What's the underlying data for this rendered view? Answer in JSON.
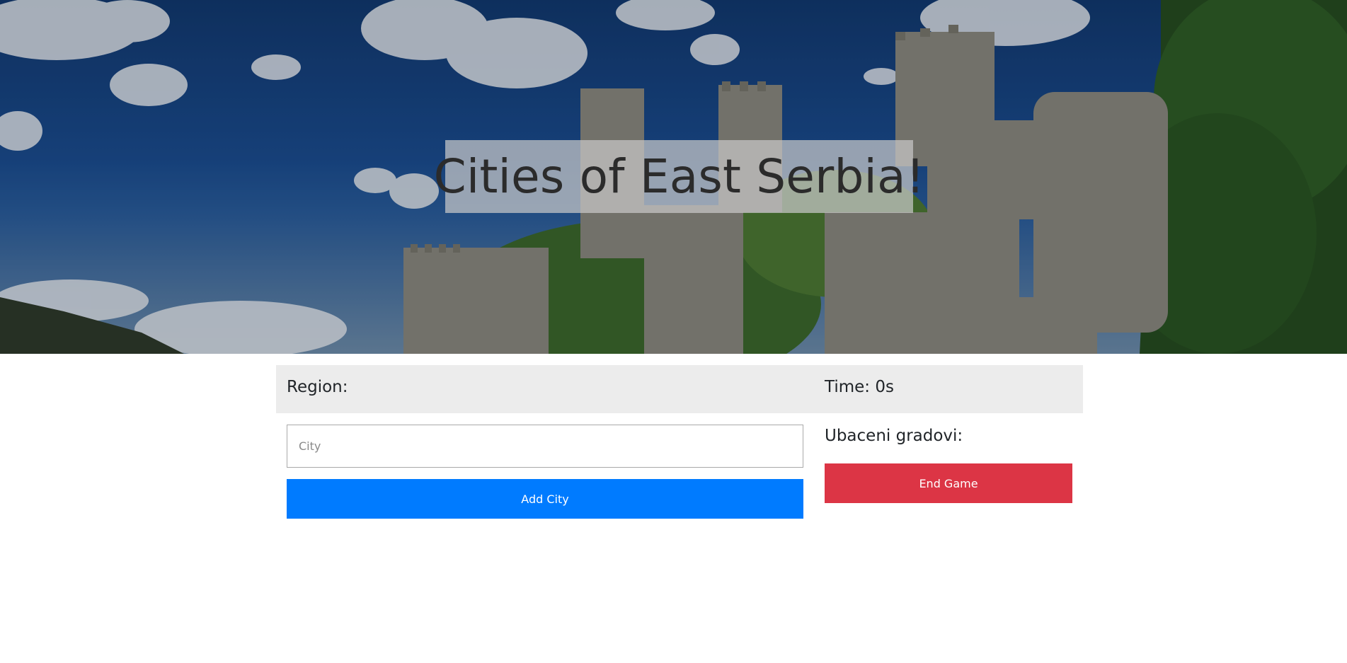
{
  "hero": {
    "title": "Cities of East Serbia!"
  },
  "status": {
    "region_label": "Region:",
    "time_label": "Time: 0s"
  },
  "form": {
    "city_placeholder": "City",
    "city_value": "",
    "add_button_label": "Add City"
  },
  "inserted": {
    "label": "Ubaceni gradovi:",
    "items": []
  },
  "controls": {
    "end_button_label": "End Game"
  },
  "colors": {
    "primary": "#007bff",
    "danger": "#dc3545",
    "status_bar_bg": "#ececec"
  }
}
